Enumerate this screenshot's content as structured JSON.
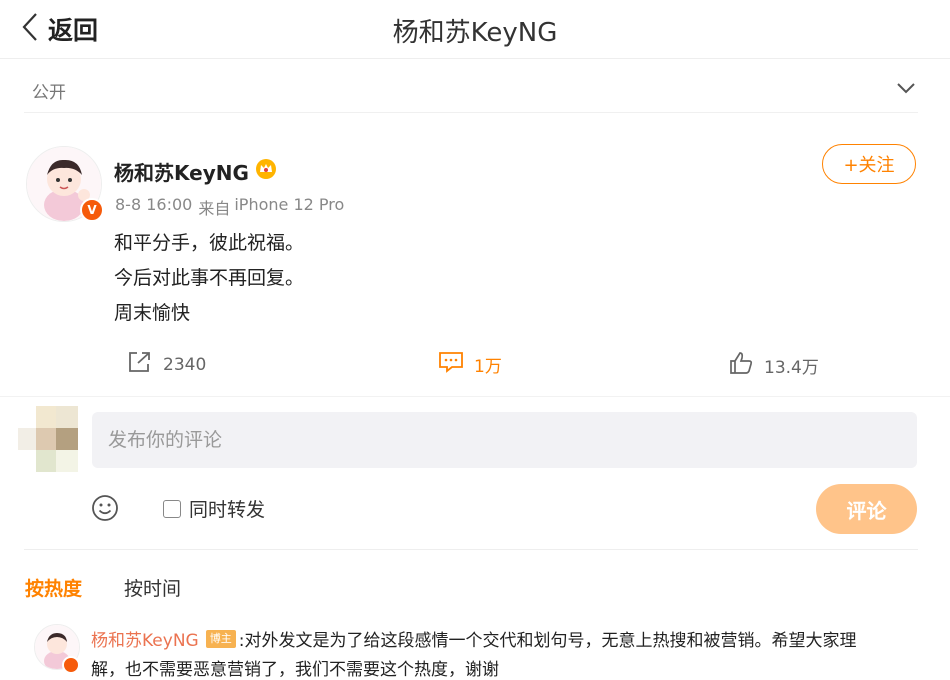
{
  "header": {
    "back_label": "返回",
    "title": "杨和苏KeyNG"
  },
  "visibility": {
    "label": "公开"
  },
  "post": {
    "author": "杨和苏KeyNG",
    "time": "8-8 16:00",
    "source_prefix": "来自",
    "source": "iPhone 12 Pro",
    "follow_label": "+关注",
    "lines": [
      "和平分手，彼此祝福。",
      "今后对此事不再回复。",
      "周末愉快"
    ]
  },
  "actions": {
    "reposts": "2340",
    "comments": "1万",
    "likes": "13.4万"
  },
  "composer": {
    "placeholder": "发布你的评论",
    "repost_label": "同时转发",
    "submit_label": "评论"
  },
  "sort": {
    "hot": "按热度",
    "time": "按时间"
  },
  "top_comment": {
    "author": "杨和苏KeyNG",
    "tag": "博主",
    "text": ":对外发文是为了给这段感情一个交代和划句号，无意上热搜和被营销。希望大家理",
    "text_cont": "解，也不需要恶意营销了，我们不需要这个热度，谢谢"
  },
  "colors": {
    "accent": "#ff8200",
    "vip_badge": "#f65b0b",
    "submit_disabled": "#ffc48a"
  }
}
